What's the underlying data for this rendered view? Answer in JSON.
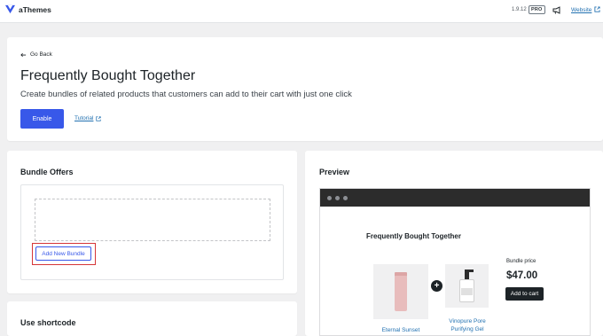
{
  "topbar": {
    "brand": "aThemes",
    "version": "1.9.12",
    "badge": "PRO",
    "website_link": "Website"
  },
  "header": {
    "back_label": "Go Back",
    "title": "Frequently Bought Together",
    "subtitle": "Create bundles of related products that customers can add to their cart with just one click",
    "enable_button": "Enable",
    "tutorial_link": "Tutorial"
  },
  "bundle_offers": {
    "title": "Bundle Offers",
    "add_button": "Add New Bundle"
  },
  "shortcode": {
    "title": "Use shortcode"
  },
  "preview": {
    "title": "Preview",
    "widget_title": "Frequently Bought Together",
    "product1_name": "Eternal Sunset",
    "product2_name": "Vinopure Pore Purifying Gel",
    "price_label": "Bundle price",
    "price": "$47.00",
    "cart_button": "Add to cart"
  },
  "colors": {
    "primary": "#3858e9",
    "link": "#2271b1",
    "highlight": "#d63638",
    "dark": "#1d2327"
  },
  "icons": [
    "athemes-logo-icon",
    "megaphone-icon",
    "external-link-icon",
    "arrow-left-icon"
  ]
}
